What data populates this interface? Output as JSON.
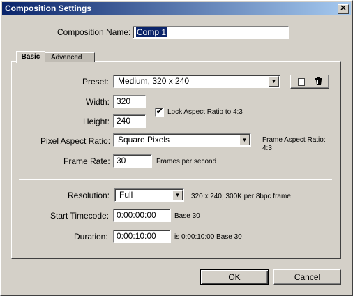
{
  "window": {
    "title": "Composition Settings",
    "close_label": "✕"
  },
  "comp_name": {
    "label": "Composition Name:",
    "value": "Comp 1"
  },
  "tabs": [
    {
      "label": "Basic"
    },
    {
      "label": "Advanced"
    }
  ],
  "basic": {
    "preset": {
      "label": "Preset:",
      "value": "Medium, 320 x 240"
    },
    "width": {
      "label": "Width:",
      "value": "320"
    },
    "height": {
      "label": "Height:",
      "value": "240"
    },
    "lock_aspect": {
      "label": "Lock Aspect Ratio to 4:3",
      "checked": true,
      "mark": "✔"
    },
    "pixel_aspect": {
      "label": "Pixel Aspect Ratio:",
      "value": "Square Pixels"
    },
    "frame_aspect": {
      "label": "Frame Aspect Ratio:",
      "value": "4:3"
    },
    "frame_rate": {
      "label": "Frame Rate:",
      "value": "30",
      "unit": "Frames per second"
    },
    "resolution": {
      "label": "Resolution:",
      "value": "Full",
      "info": "320 x 240, 300K per 8bpc frame"
    },
    "start_timecode": {
      "label": "Start Timecode:",
      "value": "0:00:00:00",
      "note": "Base 30"
    },
    "duration": {
      "label": "Duration:",
      "value": "0:00:10:00",
      "note": "is 0:00:10:00  Base 30"
    }
  },
  "buttons": {
    "ok": "OK",
    "cancel": "Cancel"
  }
}
